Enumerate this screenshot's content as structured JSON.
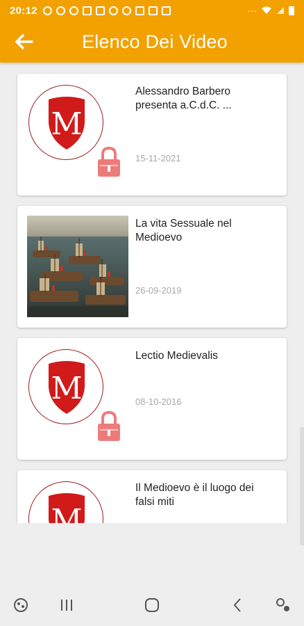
{
  "status_bar": {
    "time": "20:12",
    "overflow": "···",
    "icons": [
      "timer-icon",
      "messenger-icon",
      "messenger-icon",
      "chart-icon",
      "chart-icon",
      "eye-icon",
      "messenger-icon",
      "gmail-icon",
      "gmail-icon",
      "chess-icon"
    ],
    "right_icons": [
      "wifi-icon",
      "signal-icon",
      "battery-icon"
    ]
  },
  "app_bar": {
    "back_icon": "arrow-left-icon",
    "title": "Elenco Dei Video"
  },
  "videos": [
    {
      "title": "Alessandro Barbero presenta a.C.d.C. ...",
      "date": "15-11-2021",
      "thumbnail": "medievalis-logo",
      "locked": true
    },
    {
      "title": "La vita Sessuale nel Medioevo",
      "date": "26-09-2019",
      "thumbnail": "naval-battle-painting",
      "locked": false
    },
    {
      "title": "Lectio Medievalis",
      "date": "08-10-2016",
      "thumbnail": "medievalis-logo",
      "locked": true
    },
    {
      "title": "Il Medioevo è il luogo dei falsi miti",
      "date": "",
      "thumbnail": "medievalis-logo",
      "locked": false
    }
  ],
  "logo_letter": "M",
  "nav_bar": {
    "items": [
      "game-launcher-icon",
      "recent-apps-icon",
      "home-icon",
      "back-icon",
      "accessibility-icon"
    ]
  },
  "colors": {
    "accent": "#f2a100",
    "logo_red": "#d11a1a",
    "lock_pink": "#ee7b7b",
    "date_gray": "#a8a8a8"
  }
}
